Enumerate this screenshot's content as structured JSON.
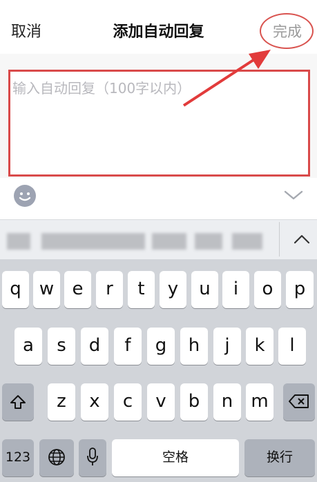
{
  "header": {
    "cancel_label": "取消",
    "title": "添加自动回复",
    "done_label": "完成"
  },
  "input": {
    "placeholder": "输入自动回复（100字以内）"
  },
  "keyboard": {
    "row1": [
      "q",
      "w",
      "e",
      "r",
      "t",
      "y",
      "u",
      "i",
      "o",
      "p"
    ],
    "row2": [
      "a",
      "s",
      "d",
      "f",
      "g",
      "h",
      "j",
      "k",
      "l"
    ],
    "row3": [
      "z",
      "x",
      "c",
      "v",
      "b",
      "n",
      "m"
    ],
    "numbers_label": "123",
    "space_label": "空格",
    "return_label": "换行"
  },
  "colors": {
    "annotation_red": "#d94a4a",
    "keyboard_bg": "#d1d4d9",
    "done_gray": "#9a9a9a"
  },
  "icons": [
    "emoji-icon",
    "chevron-down-icon",
    "chevron-up-icon",
    "shift-icon",
    "delete-icon",
    "globe-icon",
    "microphone-icon"
  ]
}
